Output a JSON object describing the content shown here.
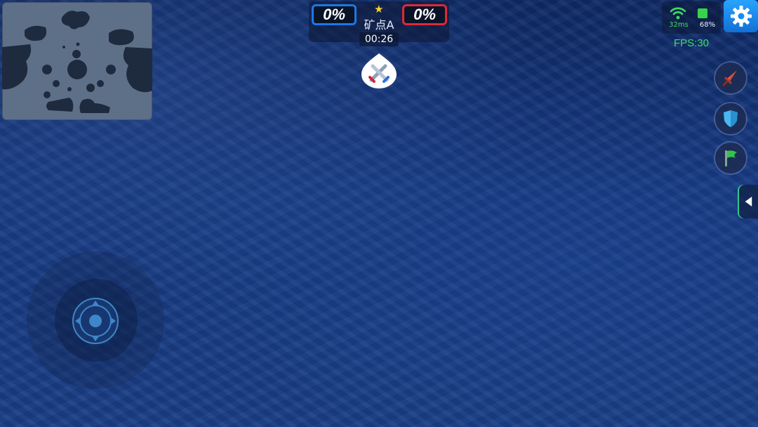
{
  "hud": {
    "blue_score": "0%",
    "red_score": "0%",
    "point_name": "矿点A",
    "timer": "00:26",
    "waypoint_icon": "crossed-swords-icon"
  },
  "status": {
    "ping": "32ms",
    "battery": "68%",
    "fps": "FPS:30"
  },
  "controls": {
    "settings_icon": "gear-icon",
    "actions": [
      "sword-icon",
      "shield-icon",
      "flag-icon"
    ],
    "side_tab_icon": "triangle-left-icon",
    "joystick_icon": "dpad-icon"
  },
  "colors": {
    "blue_team": "#1d78e6",
    "red_team": "#e02838",
    "ocean": "#163980",
    "status_green": "#3fdc62",
    "settings_blue": "#1a8cf0"
  }
}
